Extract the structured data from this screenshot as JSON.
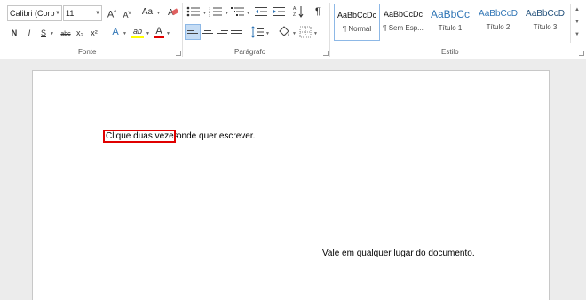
{
  "ribbon": {
    "font": {
      "family": "Calibri (Corp",
      "size": "11",
      "grow_label": "A",
      "shrink_label": "A",
      "case_label": "Aa",
      "bold": "N",
      "italic": "I",
      "underline": "S",
      "strike": "abc",
      "subscript": "x₂",
      "superscript": "x²",
      "effects_label": "A",
      "highlight_label": "ab",
      "color_label": "A",
      "group_label": "Fonte"
    },
    "paragraph": {
      "group_label": "Parágrafo",
      "pilcrow": "¶"
    },
    "styles": {
      "group_label": "Estilo",
      "items": [
        {
          "preview": "AaBbCcDc",
          "name": "¶ Normal"
        },
        {
          "preview": "AaBbCcDc",
          "name": "¶ Sem Esp..."
        },
        {
          "preview": "AaBbCc",
          "name": "Título 1"
        },
        {
          "preview": "AaBbCcD",
          "name": "Título 2"
        },
        {
          "preview": "AaBbCcD",
          "name": "Título 3"
        }
      ]
    },
    "colors": {
      "highlight": "#ffff00",
      "font_color": "#e00000",
      "accent": "#2e74b5"
    }
  },
  "document": {
    "line1_highlighted": "Clique duas vezes",
    "line1_rest": "onde quer escrever.",
    "line2": "Vale em qualquer lugar do documento."
  }
}
